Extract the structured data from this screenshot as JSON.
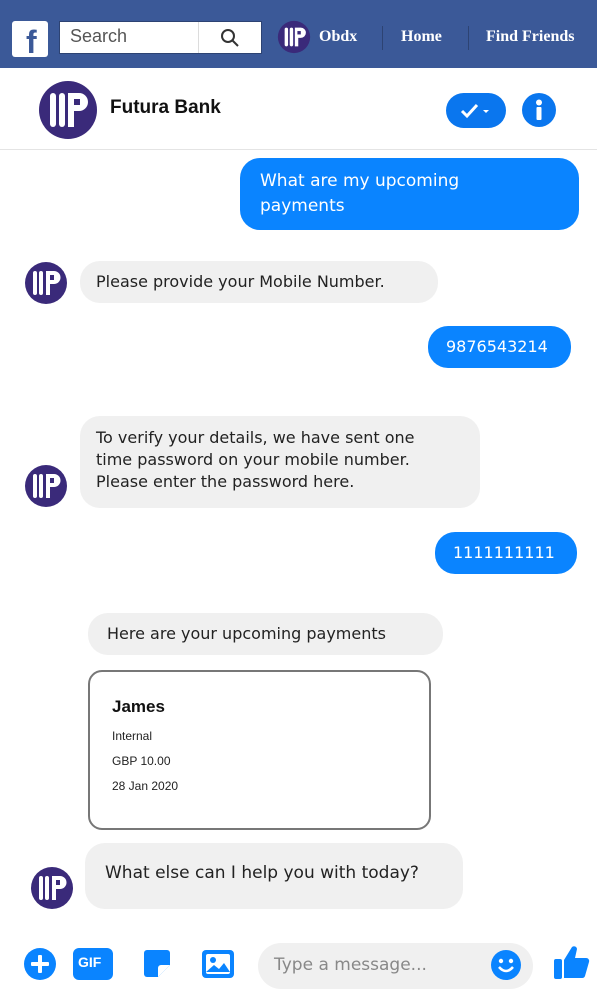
{
  "topbar": {
    "logo_letter": "f",
    "search_placeholder": "Search",
    "profile_name": "Obdx",
    "home_label": "Home",
    "find_friends_label": "Find Friends"
  },
  "chat_header": {
    "bank_name": "Futura Bank"
  },
  "messages": [
    {
      "from": "user",
      "text_lines": [
        "What are my upcoming",
        "payments"
      ]
    },
    {
      "from": "bot",
      "text": "Please provide your Mobile Number."
    },
    {
      "from": "user",
      "text": "9876543214"
    },
    {
      "from": "bot",
      "text_lines": [
        "To verify your details, we have sent one",
        "time password on your mobile number.",
        "Please enter the password here."
      ]
    },
    {
      "from": "user",
      "text": "1111111111"
    },
    {
      "from": "bot",
      "text": "Here are your upcoming payments"
    },
    {
      "from": "bot",
      "text": "What else can I help you with today?"
    }
  ],
  "payment_card": {
    "name": "James",
    "type": "Internal",
    "amount": "GBP 10.00",
    "date": "28 Jan 2020"
  },
  "composer": {
    "gif_label": "GIF",
    "placeholder": "Type a message..."
  },
  "colors": {
    "facebook_blue": "#3b5998",
    "messenger_blue": "#0a84ff",
    "bot_bubble": "#f0f0f0",
    "brand_purple": "#3a2a7a"
  }
}
